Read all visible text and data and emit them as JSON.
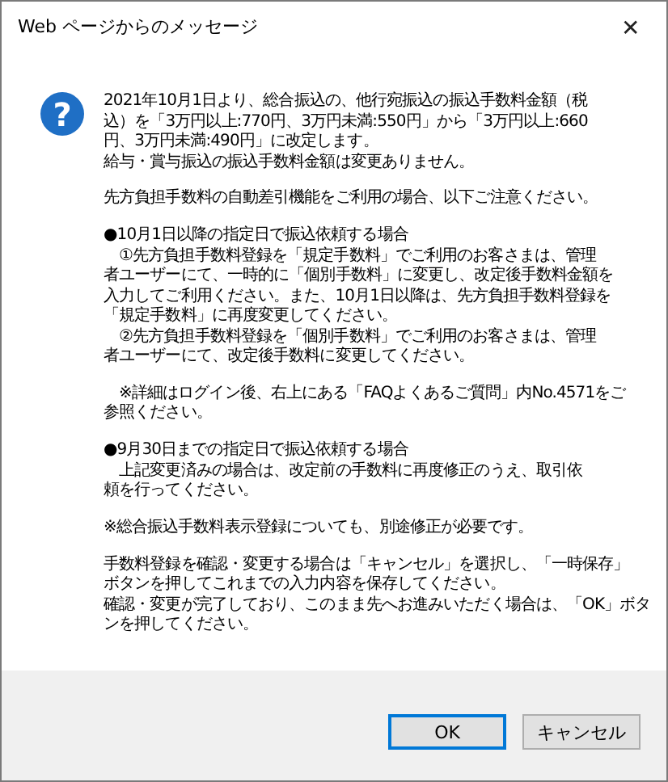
{
  "window": {
    "title": "Web ページからのメッセージ",
    "close": "✕"
  },
  "icon": "?",
  "message": [
    [
      "2021年10月1日より、総合振込の、他行宛振込の振込手数料金額（税",
      "込）を「3万円以上:770円、3万円未満:550円」から「3万円以上:660",
      "円、3万円未満:490円」に改定します。",
      "給与・賞与振込の振込手数料金額は変更ありません。"
    ],
    [
      "先方負担手数料の自動差引機能をご利用の場合、以下ご注意ください。"
    ],
    [
      "●10月1日以降の指定日で振込依頼する場合",
      "　①先方負担手数料登録を「規定手数料」でご利用のお客さまは、管理",
      "者ユーザーにて、一時的に「個別手数料」に変更し、改定後手数料金額を",
      "入力してご利用ください。また、10月1日以降は、先方負担手数料登録を",
      "「規定手数料」に再度変更してください。",
      "　②先方負担手数料登録を「個別手数料」でご利用のお客さまは、管理",
      "者ユーザーにて、改定後手数料に変更してください。"
    ],
    [
      "　※詳細はログイン後、右上にある「FAQよくあるご質問」内No.4571をご",
      "参照ください。"
    ],
    [
      "●9月30日までの指定日で振込依頼する場合",
      "　上記変更済みの場合は、改定前の手数料に再度修正のうえ、取引依",
      "頼を行ってください。"
    ],
    [
      "※総合振込手数料表示登録についても、別途修正が必要です。"
    ],
    [
      "手数料登録を確認・変更する場合は「キャンセル」を選択し、「一時保存」",
      "ボタンを押してこれまでの入力内容を保存してください。",
      "確認・変更が完了しており、このまま先へお進みいただく場合は、「OK」ボタ",
      "ンを押してください。"
    ]
  ],
  "buttons": [
    {
      "label": "OK",
      "default": true
    },
    {
      "label": "キャンセル",
      "default": false
    }
  ]
}
